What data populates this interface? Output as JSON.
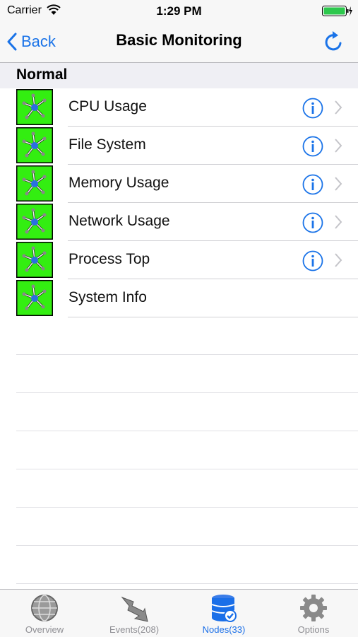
{
  "status_bar": {
    "carrier": "Carrier",
    "time": "1:29 PM"
  },
  "nav": {
    "back_label": "Back",
    "title": "Basic Monitoring",
    "refresh_icon": "refresh-icon"
  },
  "section": {
    "title": "Normal"
  },
  "rows": [
    {
      "label": "CPU Usage",
      "has_info": true
    },
    {
      "label": "File System",
      "has_info": true
    },
    {
      "label": "Memory Usage",
      "has_info": true
    },
    {
      "label": "Network Usage",
      "has_info": true
    },
    {
      "label": "Process Top",
      "has_info": true
    },
    {
      "label": "System Info",
      "has_info": false
    }
  ],
  "tabs": [
    {
      "label": "Overview",
      "icon": "globe-icon"
    },
    {
      "label": "Events(208)",
      "icon": "lightning-icon"
    },
    {
      "label": "Nodes(33)",
      "icon": "nodes-icon",
      "active": true
    },
    {
      "label": "Options",
      "icon": "gear-icon"
    }
  ],
  "colors": {
    "accent": "#1a73e8",
    "node_status": "#33ee11"
  }
}
